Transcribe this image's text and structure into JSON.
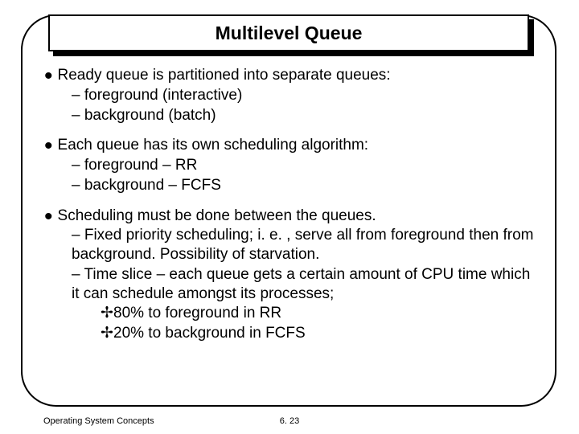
{
  "title": "Multilevel Queue",
  "bullets": {
    "b1": {
      "text": "Ready queue is partitioned into separate queues:",
      "sub1": "–  foreground (interactive)",
      "sub2": "–  background (batch)"
    },
    "b2": {
      "text": "Each queue has its own scheduling algorithm:",
      "sub1": "–  foreground – RR",
      "sub2": "–  background – FCFS"
    },
    "b3": {
      "text": "Scheduling must be done between the queues.",
      "sub1": "–  Fixed priority scheduling; i. e. , serve all from foreground then from background.  Possibility of starvation.",
      "sub2": "–  Time slice – each queue gets a certain amount of CPU time which it can schedule amongst its processes;",
      "ss1": "80% to foreground in RR",
      "ss2": "20% to background in FCFS"
    }
  },
  "footer": {
    "left": "Operating System Concepts",
    "center": "6. 23"
  },
  "glyphs": {
    "dot": "•",
    "cross": "✢"
  }
}
